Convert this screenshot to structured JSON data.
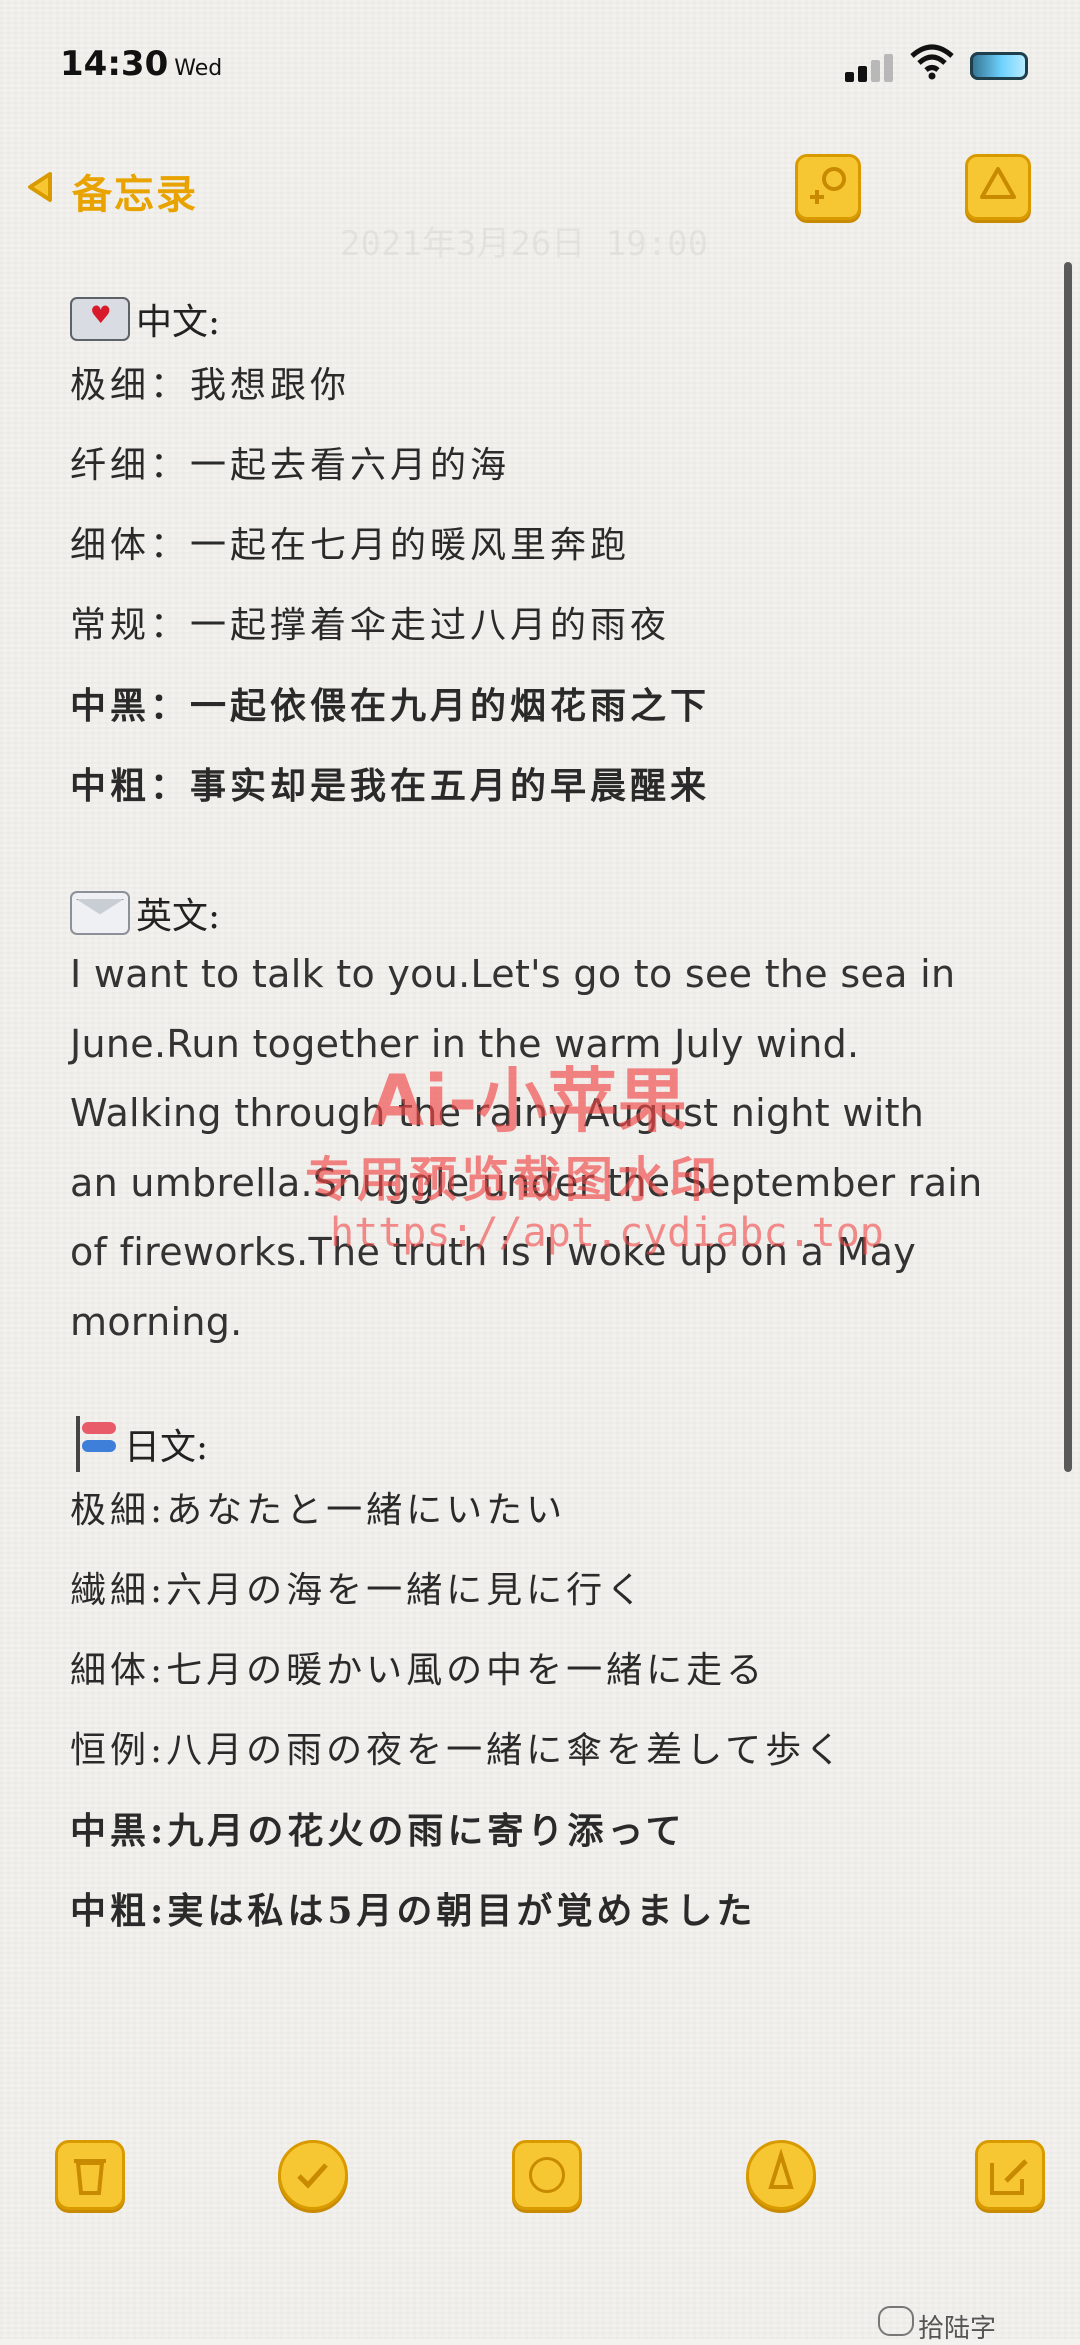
{
  "status": {
    "time": "14:30",
    "day": "Wed"
  },
  "nav": {
    "back_label": "备忘录",
    "date_text": "2021年3月26日 19:00"
  },
  "sections": {
    "chinese": {
      "heading": "中文:",
      "lines": [
        {
          "label": "极细",
          "text": "我想跟你"
        },
        {
          "label": "纤细",
          "text": "一起去看六月的海"
        },
        {
          "label": "细体",
          "text": "一起在七月的暖风里奔跑"
        },
        {
          "label": "常规",
          "text": "一起撑着伞走过八月的雨夜"
        },
        {
          "label": "中黑",
          "text": "一起依偎在九月的烟花雨之下"
        },
        {
          "label": "中粗",
          "text": "事实却是我在五月的早晨醒来"
        }
      ]
    },
    "english": {
      "heading": "英文:",
      "lines": [
        "I want to talk to you.Let's go to see the sea in",
        "June.Run together in the warm July wind.",
        "Walking through the rainy August night with",
        "an umbrella.Snuggle under the September rain",
        "of fireworks.The truth is I woke up on a May",
        "morning."
      ]
    },
    "japanese": {
      "heading": "日文:",
      "lines": [
        {
          "label": "极細",
          "text": "あなたと一緒にいたい"
        },
        {
          "label": "繊細",
          "text": "六月の海を一緒に見に行く"
        },
        {
          "label": "細体",
          "text": "七月の暖かい風の中を一緒に走る"
        },
        {
          "label": "恒例",
          "text": "八月の雨の夜を一緒に傘を差して歩く"
        },
        {
          "label": "中黒",
          "text": "九月の花火の雨に寄り添って"
        },
        {
          "label": "中粗",
          "text": "実は私は5月の朝目が覚めました"
        }
      ]
    }
  },
  "watermark": {
    "line1": "Ai-小苹果",
    "line2": "专用预览截图水印",
    "line3": "https://apt.cydiabc.top"
  },
  "footer_brand": "拾陆字"
}
